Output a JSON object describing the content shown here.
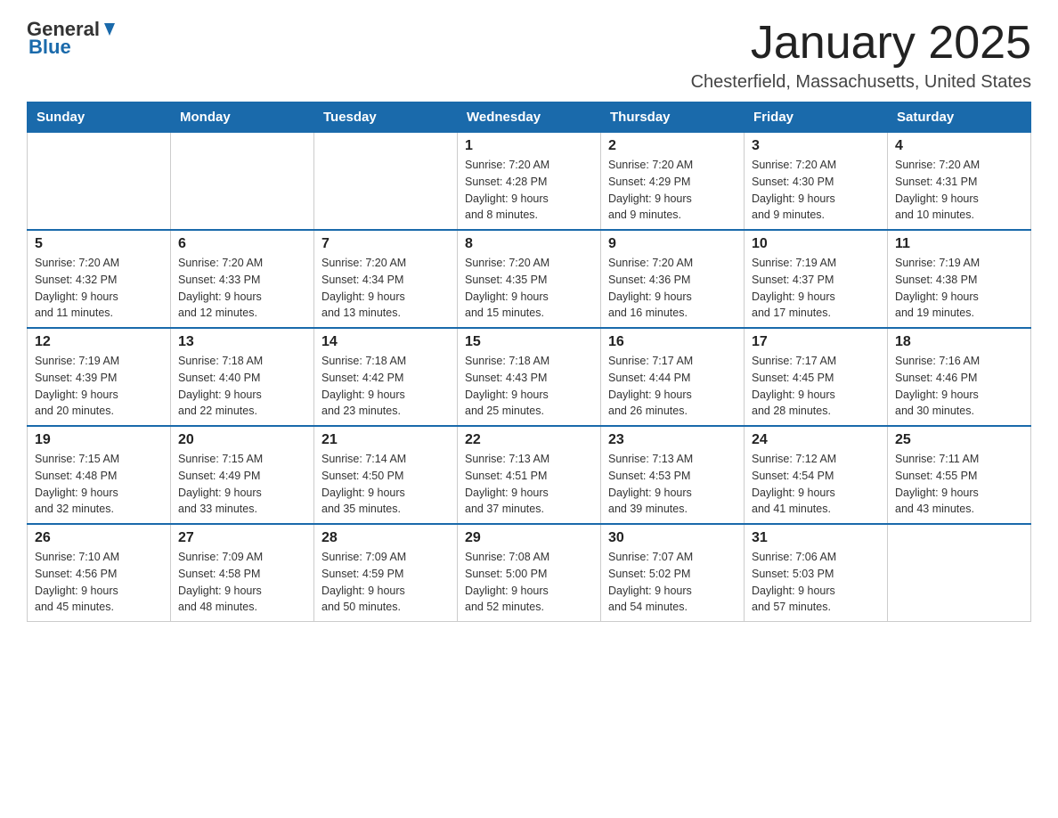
{
  "logo": {
    "general": "General",
    "blue": "Blue"
  },
  "title": "January 2025",
  "subtitle": "Chesterfield, Massachusetts, United States",
  "weekdays": [
    "Sunday",
    "Monday",
    "Tuesday",
    "Wednesday",
    "Thursday",
    "Friday",
    "Saturday"
  ],
  "weeks": [
    [
      {
        "day": "",
        "info": ""
      },
      {
        "day": "",
        "info": ""
      },
      {
        "day": "",
        "info": ""
      },
      {
        "day": "1",
        "info": "Sunrise: 7:20 AM\nSunset: 4:28 PM\nDaylight: 9 hours\nand 8 minutes."
      },
      {
        "day": "2",
        "info": "Sunrise: 7:20 AM\nSunset: 4:29 PM\nDaylight: 9 hours\nand 9 minutes."
      },
      {
        "day": "3",
        "info": "Sunrise: 7:20 AM\nSunset: 4:30 PM\nDaylight: 9 hours\nand 9 minutes."
      },
      {
        "day": "4",
        "info": "Sunrise: 7:20 AM\nSunset: 4:31 PM\nDaylight: 9 hours\nand 10 minutes."
      }
    ],
    [
      {
        "day": "5",
        "info": "Sunrise: 7:20 AM\nSunset: 4:32 PM\nDaylight: 9 hours\nand 11 minutes."
      },
      {
        "day": "6",
        "info": "Sunrise: 7:20 AM\nSunset: 4:33 PM\nDaylight: 9 hours\nand 12 minutes."
      },
      {
        "day": "7",
        "info": "Sunrise: 7:20 AM\nSunset: 4:34 PM\nDaylight: 9 hours\nand 13 minutes."
      },
      {
        "day": "8",
        "info": "Sunrise: 7:20 AM\nSunset: 4:35 PM\nDaylight: 9 hours\nand 15 minutes."
      },
      {
        "day": "9",
        "info": "Sunrise: 7:20 AM\nSunset: 4:36 PM\nDaylight: 9 hours\nand 16 minutes."
      },
      {
        "day": "10",
        "info": "Sunrise: 7:19 AM\nSunset: 4:37 PM\nDaylight: 9 hours\nand 17 minutes."
      },
      {
        "day": "11",
        "info": "Sunrise: 7:19 AM\nSunset: 4:38 PM\nDaylight: 9 hours\nand 19 minutes."
      }
    ],
    [
      {
        "day": "12",
        "info": "Sunrise: 7:19 AM\nSunset: 4:39 PM\nDaylight: 9 hours\nand 20 minutes."
      },
      {
        "day": "13",
        "info": "Sunrise: 7:18 AM\nSunset: 4:40 PM\nDaylight: 9 hours\nand 22 minutes."
      },
      {
        "day": "14",
        "info": "Sunrise: 7:18 AM\nSunset: 4:42 PM\nDaylight: 9 hours\nand 23 minutes."
      },
      {
        "day": "15",
        "info": "Sunrise: 7:18 AM\nSunset: 4:43 PM\nDaylight: 9 hours\nand 25 minutes."
      },
      {
        "day": "16",
        "info": "Sunrise: 7:17 AM\nSunset: 4:44 PM\nDaylight: 9 hours\nand 26 minutes."
      },
      {
        "day": "17",
        "info": "Sunrise: 7:17 AM\nSunset: 4:45 PM\nDaylight: 9 hours\nand 28 minutes."
      },
      {
        "day": "18",
        "info": "Sunrise: 7:16 AM\nSunset: 4:46 PM\nDaylight: 9 hours\nand 30 minutes."
      }
    ],
    [
      {
        "day": "19",
        "info": "Sunrise: 7:15 AM\nSunset: 4:48 PM\nDaylight: 9 hours\nand 32 minutes."
      },
      {
        "day": "20",
        "info": "Sunrise: 7:15 AM\nSunset: 4:49 PM\nDaylight: 9 hours\nand 33 minutes."
      },
      {
        "day": "21",
        "info": "Sunrise: 7:14 AM\nSunset: 4:50 PM\nDaylight: 9 hours\nand 35 minutes."
      },
      {
        "day": "22",
        "info": "Sunrise: 7:13 AM\nSunset: 4:51 PM\nDaylight: 9 hours\nand 37 minutes."
      },
      {
        "day": "23",
        "info": "Sunrise: 7:13 AM\nSunset: 4:53 PM\nDaylight: 9 hours\nand 39 minutes."
      },
      {
        "day": "24",
        "info": "Sunrise: 7:12 AM\nSunset: 4:54 PM\nDaylight: 9 hours\nand 41 minutes."
      },
      {
        "day": "25",
        "info": "Sunrise: 7:11 AM\nSunset: 4:55 PM\nDaylight: 9 hours\nand 43 minutes."
      }
    ],
    [
      {
        "day": "26",
        "info": "Sunrise: 7:10 AM\nSunset: 4:56 PM\nDaylight: 9 hours\nand 45 minutes."
      },
      {
        "day": "27",
        "info": "Sunrise: 7:09 AM\nSunset: 4:58 PM\nDaylight: 9 hours\nand 48 minutes."
      },
      {
        "day": "28",
        "info": "Sunrise: 7:09 AM\nSunset: 4:59 PM\nDaylight: 9 hours\nand 50 minutes."
      },
      {
        "day": "29",
        "info": "Sunrise: 7:08 AM\nSunset: 5:00 PM\nDaylight: 9 hours\nand 52 minutes."
      },
      {
        "day": "30",
        "info": "Sunrise: 7:07 AM\nSunset: 5:02 PM\nDaylight: 9 hours\nand 54 minutes."
      },
      {
        "day": "31",
        "info": "Sunrise: 7:06 AM\nSunset: 5:03 PM\nDaylight: 9 hours\nand 57 minutes."
      },
      {
        "day": "",
        "info": ""
      }
    ]
  ]
}
